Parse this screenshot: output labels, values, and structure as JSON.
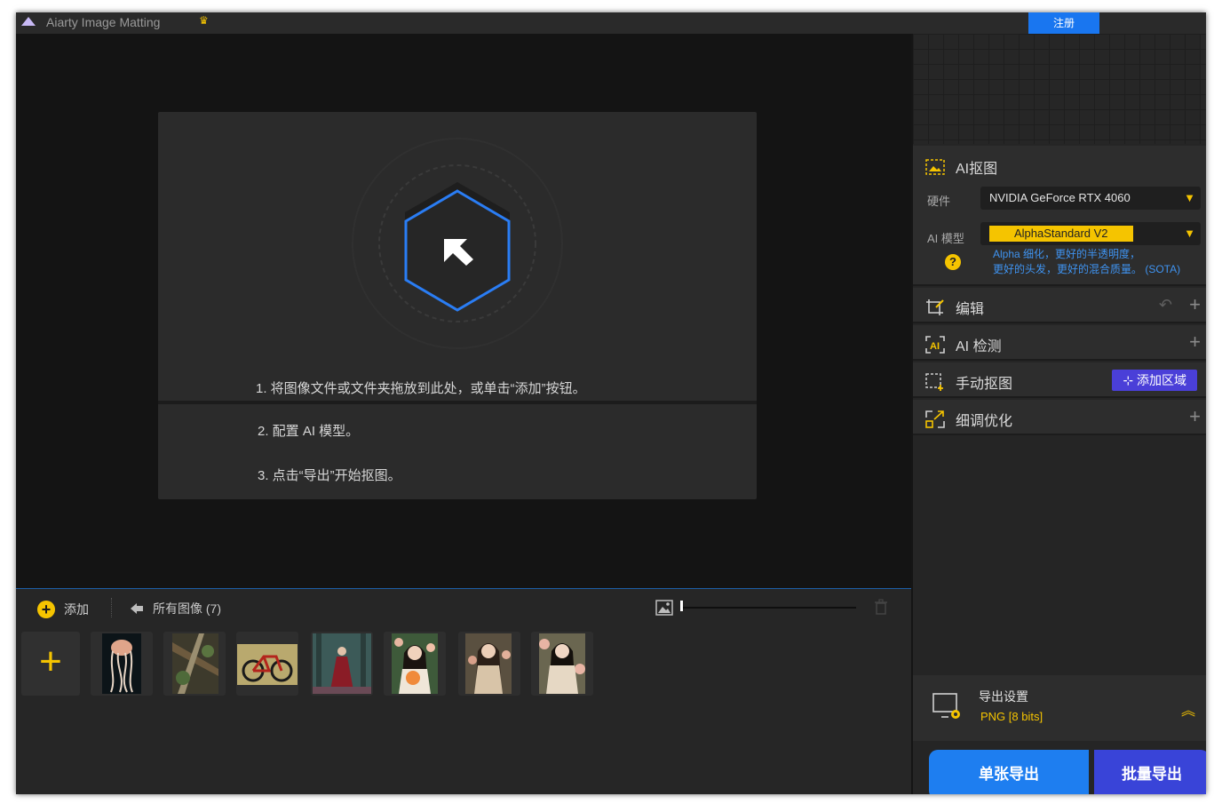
{
  "app": {
    "title": "Aiarty Image Matting",
    "title_button": "注册"
  },
  "drop_zone": {
    "step1": "1. 将图像文件或文件夹拖放到此处，或单击“添加”按钮。",
    "step2": "2. 配置 AI 模型。",
    "step3": "3. 点击“导出”开始抠图。"
  },
  "bottom_bar": {
    "add_label": "添加",
    "all_images_label": "所有图像 (7)",
    "add_thumb_glyph": "+",
    "thumbnails": [
      {
        "subject": "jellyfish"
      },
      {
        "subject": "forest-debris"
      },
      {
        "subject": "bicycle"
      },
      {
        "subject": "woman-in-forest"
      },
      {
        "subject": "woman-with-flowers"
      },
      {
        "subject": "woman-in-garden"
      },
      {
        "subject": "woman-with-roses"
      }
    ]
  },
  "right_panel": {
    "ai_matting": {
      "title": "AI抠图",
      "hardware_label": "硬件",
      "hardware_value": "NVIDIA GeForce RTX 4060",
      "model_label": "AI 模型",
      "model_value": "AlphaStandard  V2",
      "model_desc_line1": "Alpha 细化，更好的半透明度，",
      "model_desc_line2": "更好的头发，更好的混合质量。  (SOTA)",
      "help_glyph": "?"
    },
    "edit": {
      "title": "编辑"
    },
    "ai_detect": {
      "title": "AI 检测"
    },
    "manual_matting": {
      "title": "手动抠图",
      "add_region": "添加区域"
    },
    "refine": {
      "title": "细调优化"
    },
    "export_settings": {
      "title": "导出设置",
      "format": "PNG    [8 bits]"
    },
    "export_single": "单张导出",
    "export_batch": "批量导出"
  },
  "colors": {
    "accent_yellow": "#f5c400",
    "accent_blue": "#1e7ef0",
    "accent_purple": "#3944d8"
  }
}
